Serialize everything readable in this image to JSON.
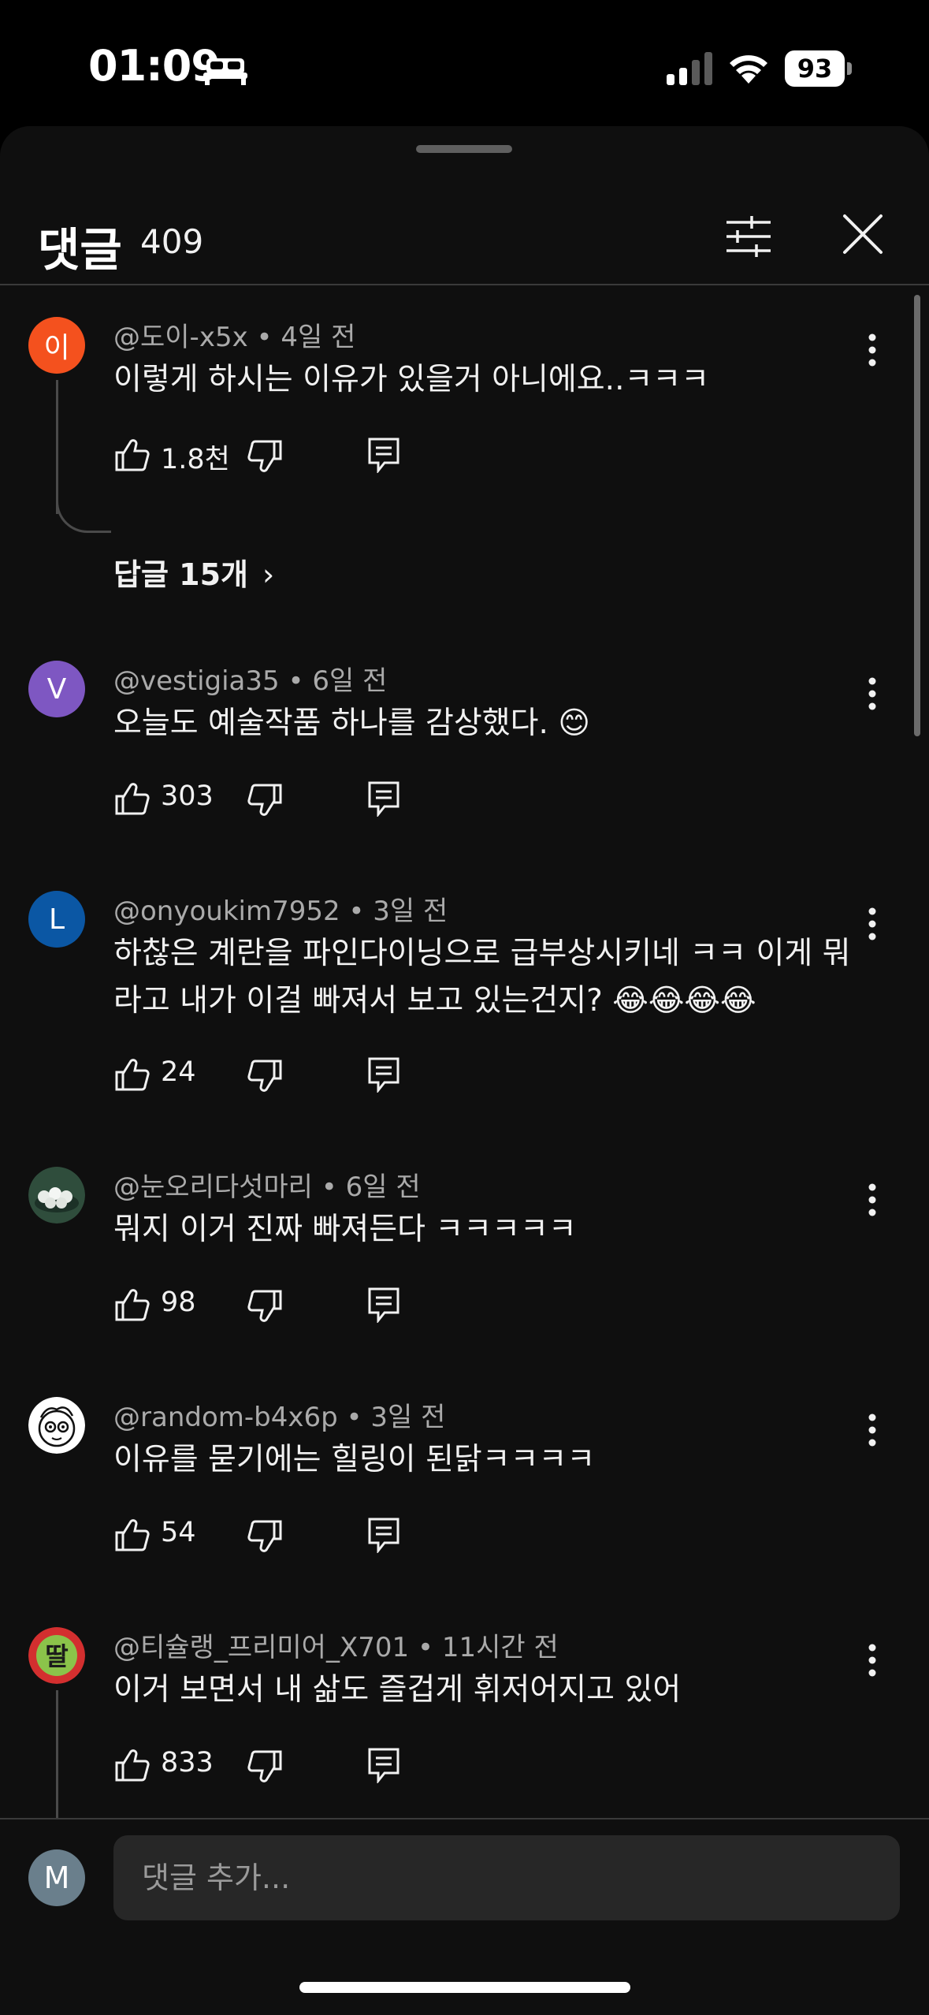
{
  "status": {
    "time": "01:09",
    "battery": "93",
    "focus_icon": "bed-icon",
    "colors": {
      "background": "#000000",
      "text": "#ffffff"
    }
  },
  "sheet": {
    "title": "댓글",
    "count": "409",
    "filter_icon": "filter-sliders-icon",
    "close_icon": "close-icon"
  },
  "comments": [
    {
      "author": "@도이-x5x",
      "age": "4일 전",
      "text": "이렇게 하시는 이유가 있을거 아니에요..ㅋㅋㅋ",
      "likes": "1.8천",
      "avatar_letter": "이",
      "avatar_color": "#f4511e",
      "replies_label": "답글 15개",
      "replies_chevron": "›"
    },
    {
      "author": "@vestigia35",
      "age": "6일 전",
      "text": "오늘도 예술작품 하나를 감상했다. 😊",
      "likes": "303",
      "avatar_letter": "V",
      "avatar_color": "#7e57c2"
    },
    {
      "author": "@onyoukim7952",
      "age": "3일 전",
      "text": "하찮은 계란을 파인다이닝으로 급부상시키네 ㅋㅋ 이게 뭐라고 내가 이걸 빠져서 보고 있는건지? 😂😂😂😂",
      "likes": "24",
      "avatar_letter": "L",
      "avatar_color": "#0b57a4"
    },
    {
      "author": "@눈오리다섯마리",
      "age": "6일 전",
      "text": "뭐지 이거 진짜 빠져든다 ㅋㅋㅋㅋㅋ",
      "likes": "98",
      "avatar_letter": "",
      "avatar_color": "#2e4a3a"
    },
    {
      "author": "@random-b4x6p",
      "age": "3일 전",
      "text": "이유를 묻기에는 힐링이 된닭ㅋㅋㅋㅋ",
      "likes": "54",
      "avatar_letter": "",
      "avatar_color": "#ffffff"
    },
    {
      "author": "@티슐랭_프리미어_X701",
      "age": "11시간 전",
      "text": "이거 보면서 내 삶도 즐겁게 휘저어지고 있어",
      "likes": "833",
      "avatar_letter": "딸",
      "avatar_color": "#e53935"
    }
  ],
  "meta_separator": "•",
  "input": {
    "avatar_letter": "M",
    "placeholder": "댓글 추가..."
  }
}
